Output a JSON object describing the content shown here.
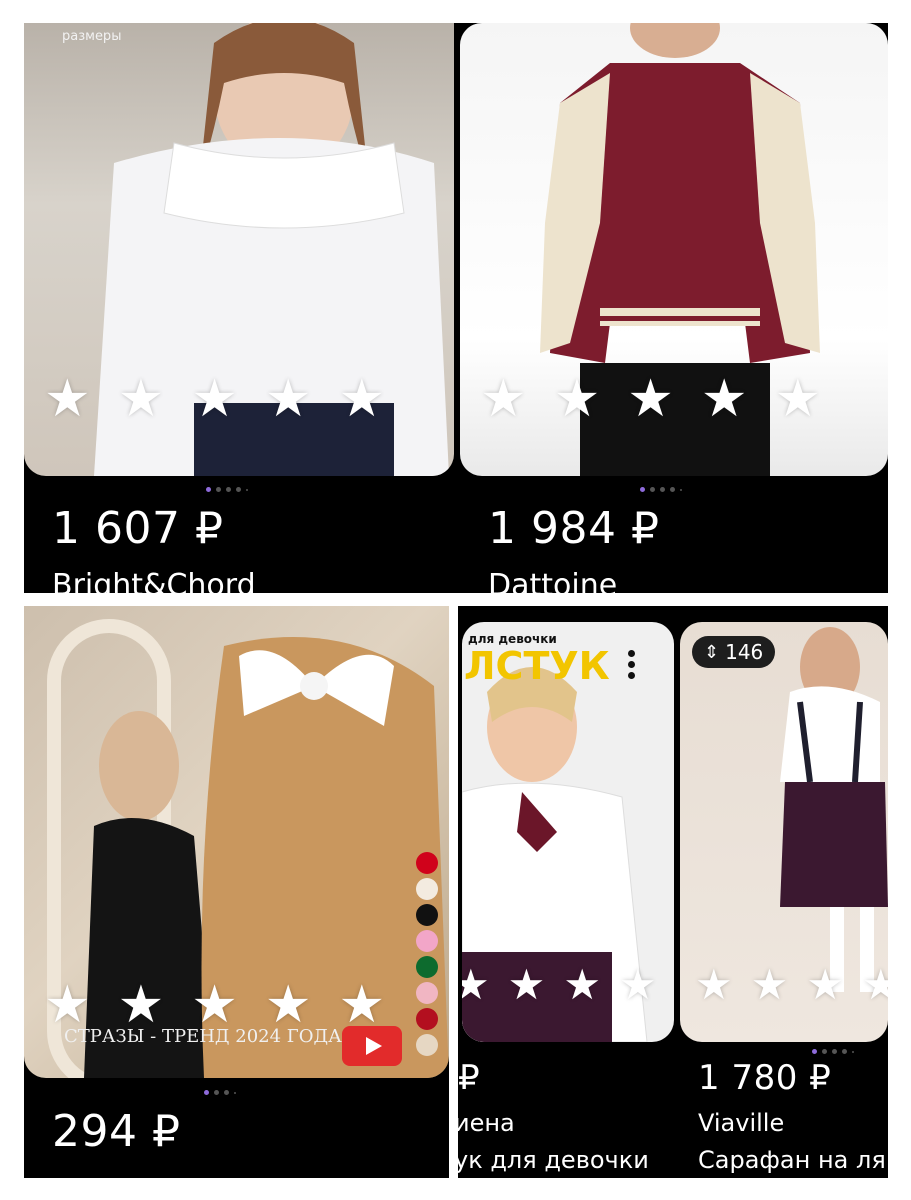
{
  "cards": [
    {
      "size_label": "размеры",
      "price": "1 607 ₽",
      "brand": "Bright&Chord",
      "rating_stars": 5
    },
    {
      "price": "1 984 ₽",
      "brand": "Dattoine",
      "rating_stars": 5
    },
    {
      "price": "294 ₽",
      "banner": "СТРАЗЫ - ТРЕНД 2024 ГОДА",
      "rating_stars": 5,
      "swatches": [
        "#d0021b",
        "#f3ebe0",
        "#111111",
        "#f2a6c8",
        "#0d6b2e",
        "#f1b6c3",
        "#b30f1f",
        "#e6d7c3"
      ]
    },
    {
      "header_small": "для девочки",
      "header_big": "ЛСТУК",
      "price": "₽",
      "brand": "иена",
      "desc": "ук для девочки",
      "rating_stars": 3
    },
    {
      "badge_count": "146",
      "price": "1 780 ₽",
      "brand": "Viaville",
      "desc": "Сарафан на ля",
      "rating_stars": 4
    }
  ],
  "colors": {
    "background": "#000000",
    "page_bg": "#ffffff",
    "active_dot": "#8e6bdb",
    "jacket_body": "#7d1c2d",
    "jacket_sleeve": "#ede3cd"
  },
  "icons": [
    "star-icon",
    "ruler-icon",
    "kebab-menu-icon",
    "play-icon",
    "diamond-icon"
  ]
}
